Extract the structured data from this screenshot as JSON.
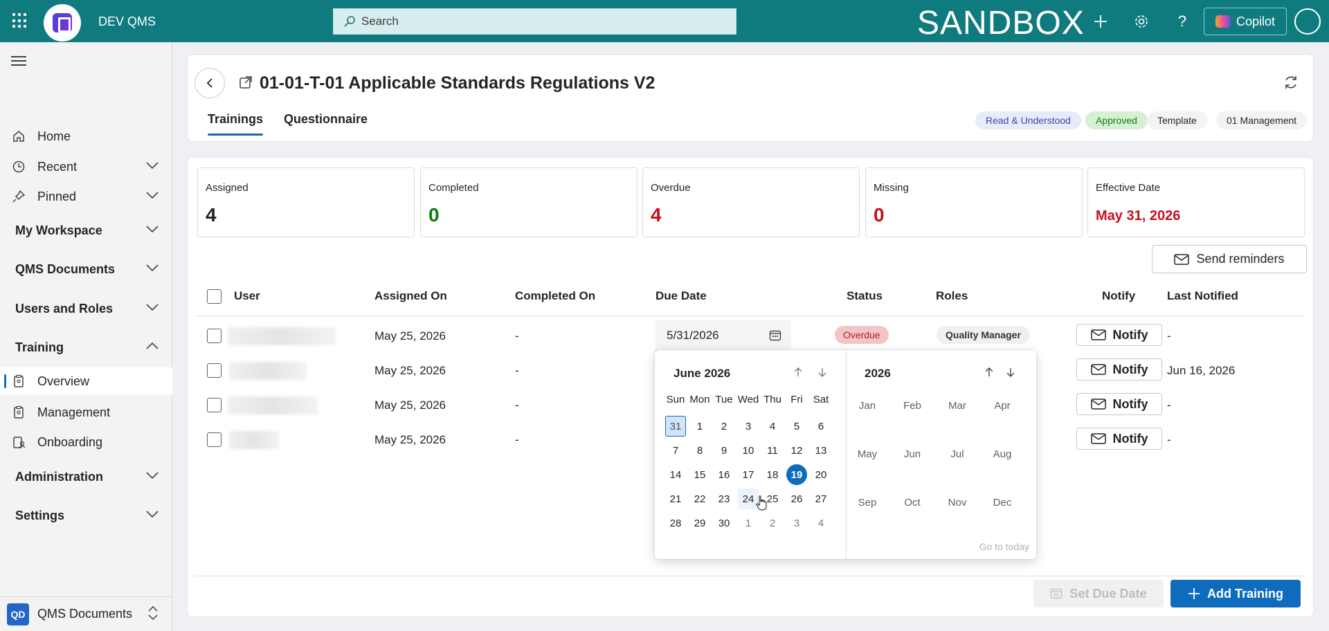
{
  "topbar": {
    "app_name": "DEV QMS",
    "search_placeholder": "Search",
    "env_label": "SANDBOX",
    "copilot_label": "Copilot"
  },
  "sidebar": {
    "items": [
      {
        "label": "Home",
        "icon": "home-icon"
      },
      {
        "label": "Recent",
        "icon": "clock-icon"
      },
      {
        "label": "Pinned",
        "icon": "pin-icon"
      },
      {
        "label": "My Workspace"
      },
      {
        "label": "QMS Documents"
      },
      {
        "label": "Users and Roles"
      },
      {
        "label": "Training"
      },
      {
        "label": "Overview",
        "icon": "clipboard-icon"
      },
      {
        "label": "Management",
        "icon": "clipboard-icon"
      },
      {
        "label": "Onboarding",
        "icon": "clipboard-people-icon"
      },
      {
        "label": "Administration"
      },
      {
        "label": "Settings"
      }
    ],
    "footer": {
      "badge": "QD",
      "label": "QMS Documents"
    }
  },
  "header": {
    "title": "01-01-T-01 Applicable Standards Regulations V2",
    "tabs": [
      "Trainings",
      "Questionnaire"
    ],
    "pills": [
      "Read & Understood",
      "Approved",
      "Template",
      "01 Management"
    ]
  },
  "stats": [
    {
      "label": "Assigned",
      "value": "4"
    },
    {
      "label": "Completed",
      "value": "0"
    },
    {
      "label": "Overdue",
      "value": "4"
    },
    {
      "label": "Missing",
      "value": "0"
    },
    {
      "label": "Effective Date",
      "value": "May 31, 2026"
    }
  ],
  "send_reminders_label": "Send reminders",
  "table": {
    "headers": [
      "User",
      "Assigned On",
      "Completed On",
      "Due Date",
      "Status",
      "Roles",
      "Notify",
      "Last Notified"
    ],
    "rows": [
      {
        "assigned_on": "May 25, 2026",
        "completed_on": "-",
        "due_date": "5/31/2026",
        "status": "Overdue",
        "role": "Quality Manager",
        "notify": "Notify",
        "last_notified": "-"
      },
      {
        "assigned_on": "May 25, 2026",
        "completed_on": "-",
        "notify": "Notify",
        "last_notified": "Jun 16, 2026"
      },
      {
        "assigned_on": "May 25, 2026",
        "completed_on": "-",
        "notify": "Notify",
        "last_notified": "-"
      },
      {
        "assigned_on": "May 25, 2026",
        "completed_on": "-",
        "notify": "Notify",
        "last_notified": "-"
      }
    ]
  },
  "buttons": {
    "set_due_date": "Set Due Date",
    "add_training": "Add Training"
  },
  "datepicker": {
    "month_title": "June 2026",
    "year_title": "2026",
    "weekdays": [
      "Sun",
      "Mon",
      "Tue",
      "Wed",
      "Thu",
      "Fri",
      "Sat"
    ],
    "weeks": [
      [
        "31",
        "1",
        "2",
        "3",
        "4",
        "5",
        "6"
      ],
      [
        "7",
        "8",
        "9",
        "10",
        "11",
        "12",
        "13"
      ],
      [
        "14",
        "15",
        "16",
        "17",
        "18",
        "19",
        "20"
      ],
      [
        "21",
        "22",
        "23",
        "24",
        "25",
        "26",
        "27"
      ],
      [
        "28",
        "29",
        "30",
        "1",
        "2",
        "3",
        "4"
      ]
    ],
    "months": [
      "Jan",
      "Feb",
      "Mar",
      "Apr",
      "May",
      "Jun",
      "Jul",
      "Aug",
      "Sep",
      "Oct",
      "Nov",
      "Dec"
    ],
    "goto_today": "Go to today"
  },
  "colors": {
    "brand": "#0f7b7f",
    "accent": "#0f6cbd",
    "danger": "#c50f1f",
    "success": "#107c10"
  }
}
